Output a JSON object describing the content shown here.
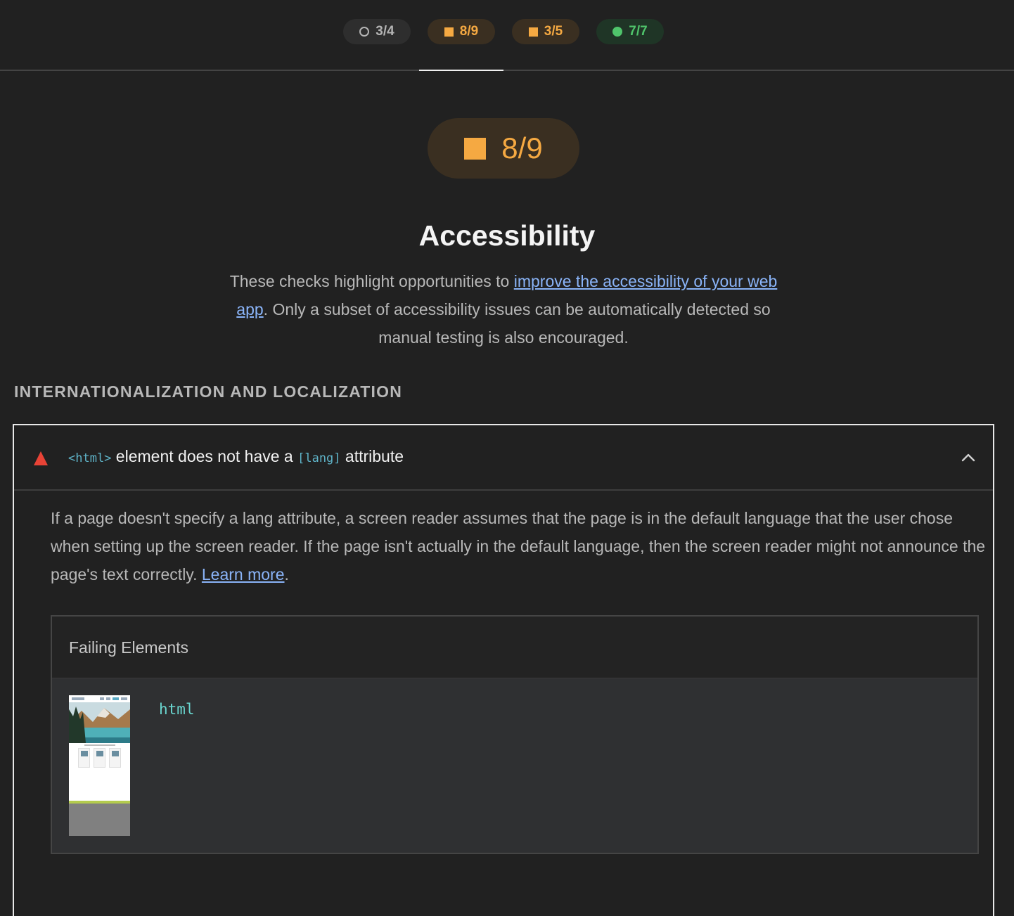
{
  "score_tabs": [
    {
      "label": "3/4",
      "rating": "neutral"
    },
    {
      "label": "8/9",
      "rating": "average"
    },
    {
      "label": "3/5",
      "rating": "average"
    },
    {
      "label": "7/7",
      "rating": "pass"
    }
  ],
  "active_tab_index": 1,
  "category": {
    "score": "8/9",
    "title": "Accessibility",
    "description_before": "These checks highlight opportunities to ",
    "description_link": "improve the accessibility of your web app",
    "description_after": ". Only a subset of accessibility issues can be automatically detected so manual testing is also encouraged."
  },
  "group": {
    "heading": "INTERNATIONALIZATION AND LOCALIZATION"
  },
  "audit": {
    "status": "fail",
    "title_code1": "<html>",
    "title_mid": " element does not have a ",
    "title_code2": "[lang]",
    "title_end": " attribute",
    "expanded": true,
    "description": "If a page doesn't specify a lang attribute, a screen reader assumes that the page is in the default language that the user chose when setting up the screen reader. If the page isn't actually in the default language, then the screen reader might not announce the page's text correctly. ",
    "learn_more": "Learn more",
    "learn_more_after": ".",
    "details": {
      "header": "Failing Elements",
      "items": [
        {
          "node": "html"
        }
      ]
    }
  },
  "colors": {
    "background": "#212121",
    "average": "#f5a942",
    "pass": "#4fc46b",
    "fail": "#e84336",
    "link": "#8ab4f8",
    "code": "#5fb4c9"
  },
  "icons": {
    "fail": "triangle-fail-icon",
    "collapse": "chevron-up-icon",
    "neutral": "circle-outline-icon",
    "average": "square-icon",
    "pass": "circle-filled-icon"
  }
}
